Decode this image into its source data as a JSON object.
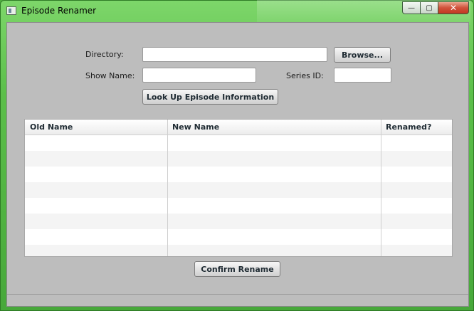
{
  "window": {
    "title": "Episode Renamer",
    "minimize_glyph": "—",
    "maximize_glyph": "▢",
    "close_glyph": "✕"
  },
  "form": {
    "directory_label": "Directory:",
    "directory_value": "",
    "browse_label": "Browse...",
    "show_name_label": "Show Name:",
    "show_name_value": "",
    "series_id_label": "Series ID:",
    "series_id_value": "",
    "lookup_label": "Look Up Episode Information"
  },
  "table": {
    "columns": [
      "Old Name",
      "New Name",
      "Renamed?"
    ],
    "rows": [
      [
        "",
        "",
        ""
      ],
      [
        "",
        "",
        ""
      ],
      [
        "",
        "",
        ""
      ],
      [
        "",
        "",
        ""
      ],
      [
        "",
        "",
        ""
      ],
      [
        "",
        "",
        ""
      ],
      [
        "",
        "",
        ""
      ],
      [
        "",
        "",
        ""
      ]
    ]
  },
  "actions": {
    "confirm_label": "Confirm Rename"
  },
  "status": {
    "text": ""
  }
}
